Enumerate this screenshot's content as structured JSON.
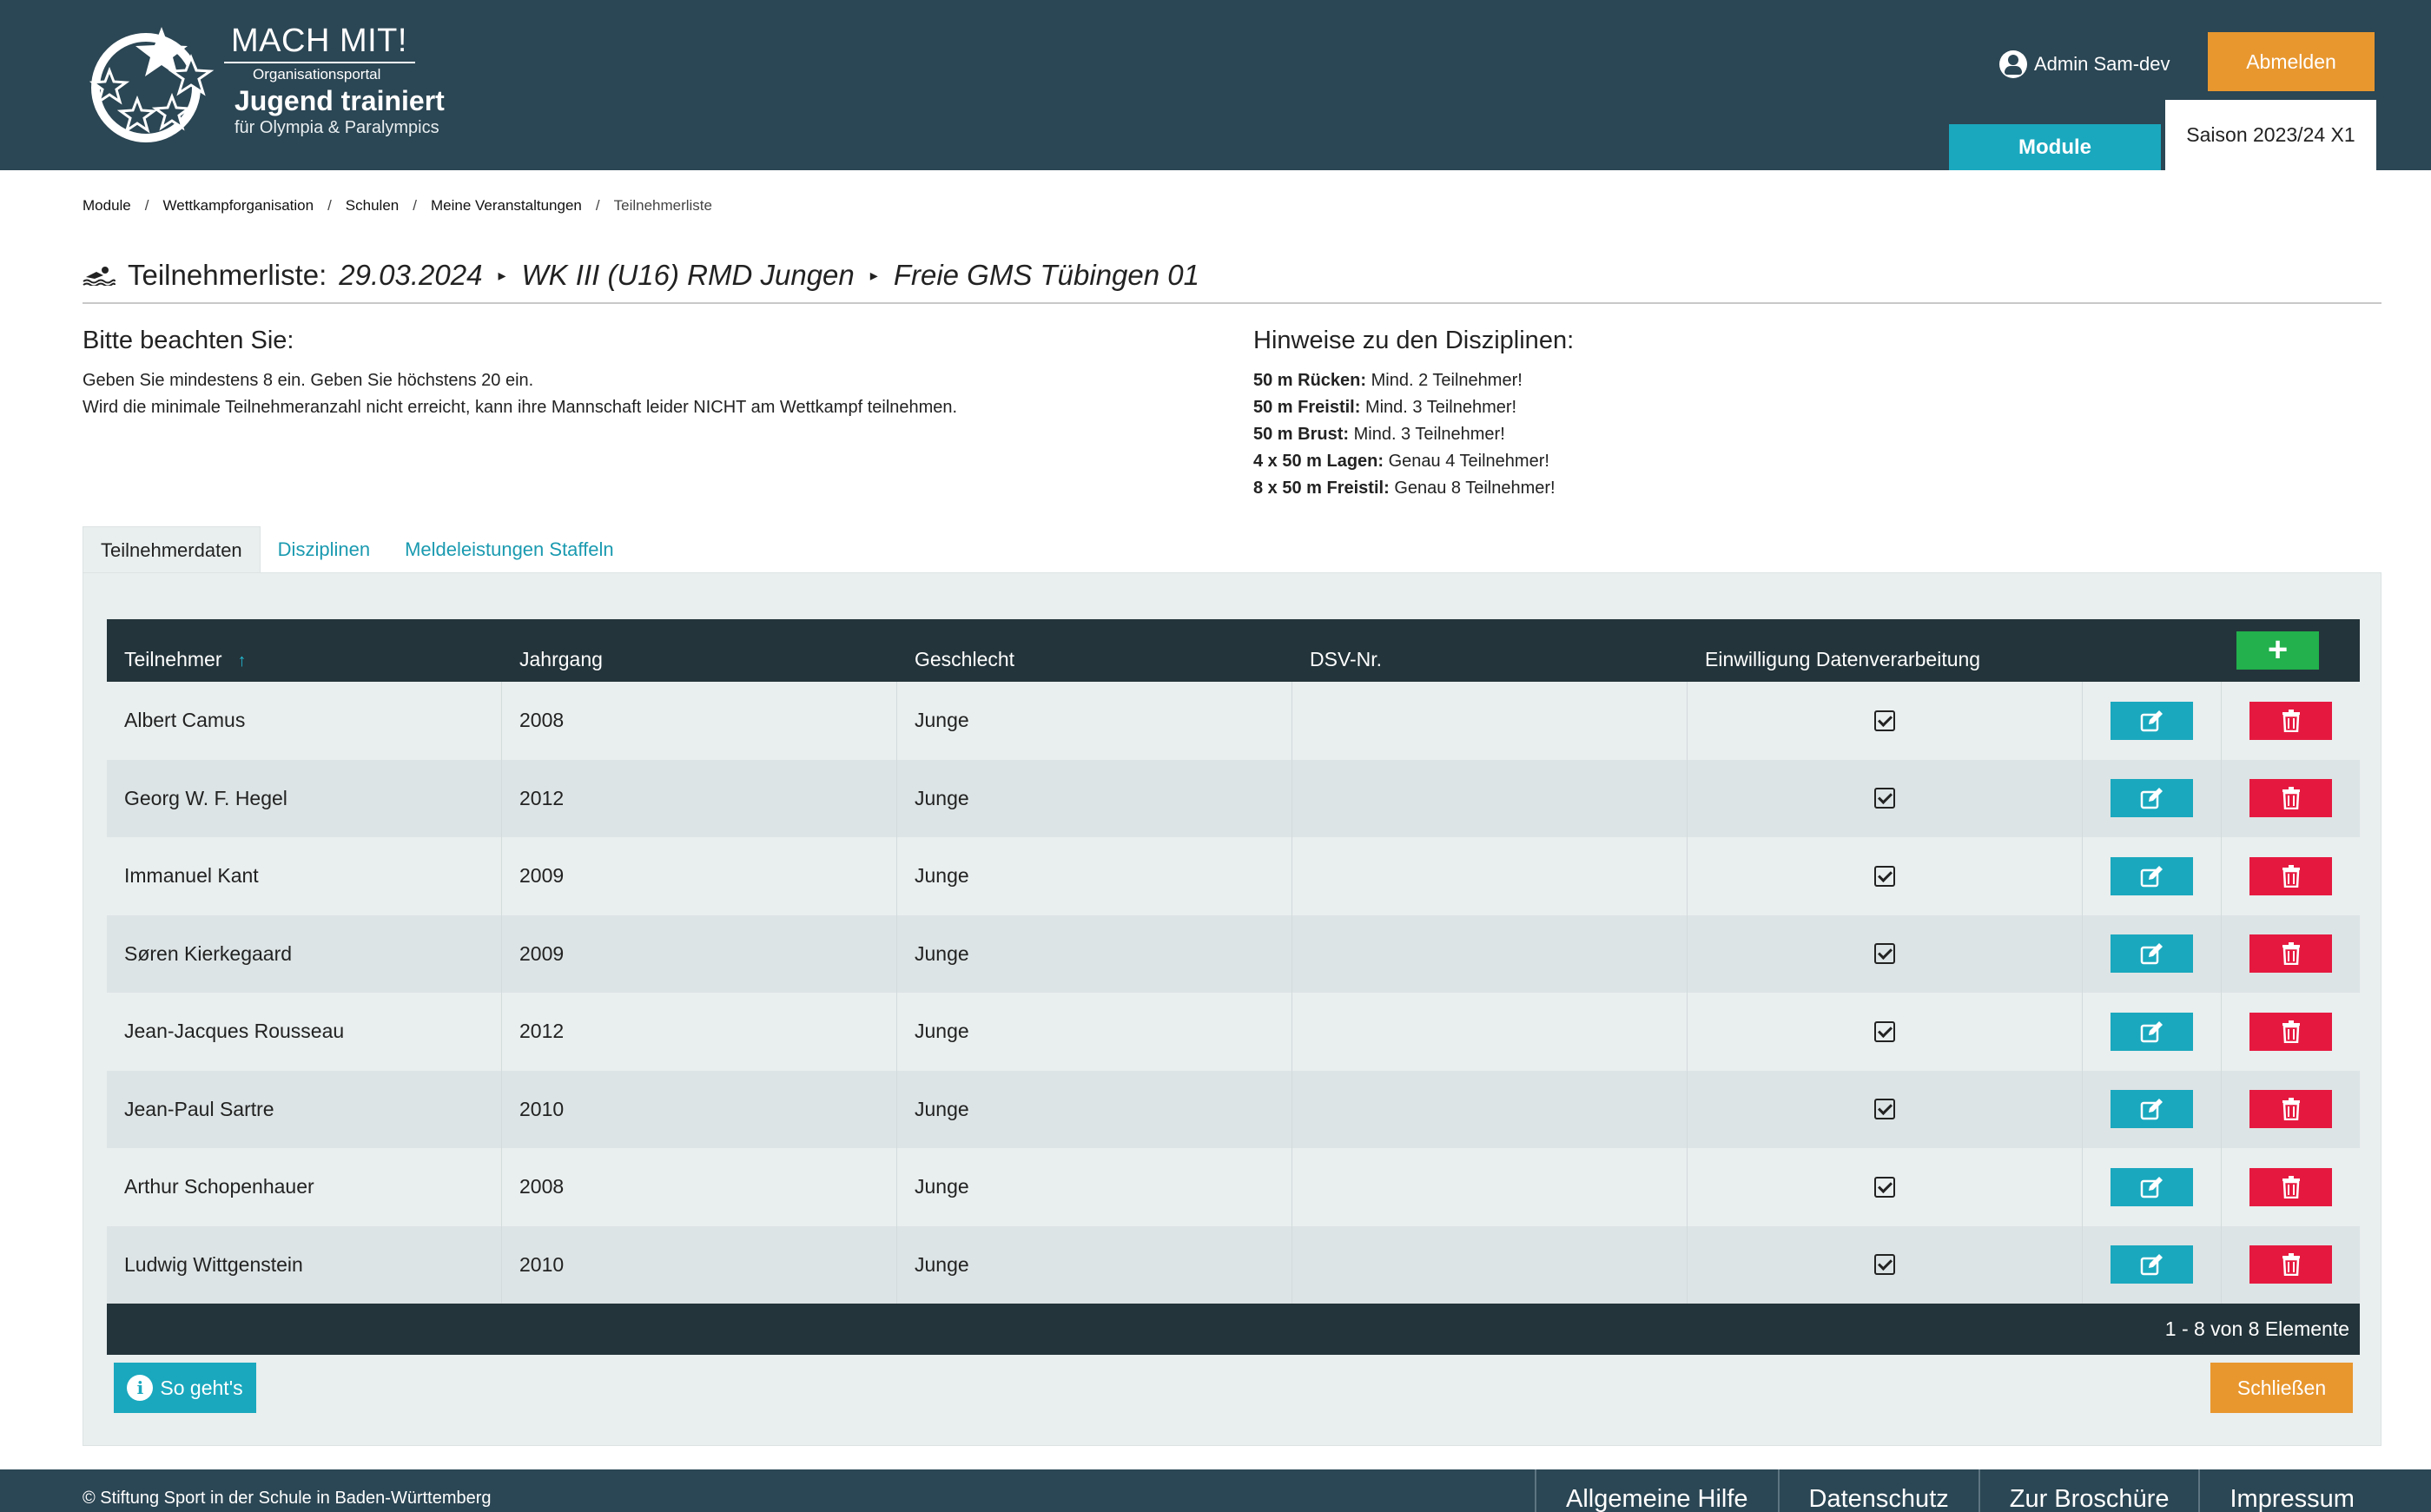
{
  "header": {
    "logo_title": "MACH MIT!",
    "logo_subtitle": "Organisationsportal",
    "logo_brand": "Jugend trainiert",
    "logo_tagline": "für Olympia & Paralympics",
    "user_name": "Admin Sam-dev",
    "logout_label": "Abmelden",
    "module_tab_label": "Module",
    "season_label": "Saison 2023/24 X1"
  },
  "breadcrumb": [
    "Module",
    "Wettkampforganisation",
    "Schulen",
    "Meine Veranstaltungen",
    "Teilnehmerliste"
  ],
  "title": {
    "prefix": "Teilnehmerliste:",
    "date": "29.03.2024",
    "competition": "WK III (U16) RMD Jungen",
    "school": "Freie GMS Tübingen 01"
  },
  "notes": {
    "heading": "Bitte beachten Sie:",
    "line1": "Geben Sie mindestens 8 ein. Geben Sie höchstens 20 ein.",
    "line2": "Wird die minimale Teilnehmeranzahl nicht erreicht, kann ihre Mannschaft leider NICHT am Wettkampf teilnehmen."
  },
  "disciplines": {
    "heading": "Hinweise zu den Disziplinen:",
    "items": [
      {
        "name": "50 m Rücken:",
        "text": "Mind. 2 Teilnehmer!"
      },
      {
        "name": "50 m Freistil:",
        "text": "Mind. 3 Teilnehmer!"
      },
      {
        "name": "50 m Brust:",
        "text": "Mind. 3 Teilnehmer!"
      },
      {
        "name": "4 x 50 m Lagen:",
        "text": "Genau 4 Teilnehmer!"
      },
      {
        "name": "8 x 50 m Freistil:",
        "text": "Genau 8 Teilnehmer!"
      }
    ]
  },
  "tabs": [
    "Teilnehmerdaten",
    "Disziplinen",
    "Meldeleistungen Staffeln"
  ],
  "table": {
    "columns": [
      "Teilnehmer",
      "Jahrgang",
      "Geschlecht",
      "DSV-Nr.",
      "Einwilligung Datenverarbeitung"
    ],
    "sort_indicator": "↑",
    "add_label": "+",
    "rows": [
      {
        "name": "Albert Camus",
        "year": "2008",
        "gender": "Junge",
        "dsv": "",
        "consent": true
      },
      {
        "name": "Georg W. F. Hegel",
        "year": "2012",
        "gender": "Junge",
        "dsv": "",
        "consent": true
      },
      {
        "name": "Immanuel Kant",
        "year": "2009",
        "gender": "Junge",
        "dsv": "",
        "consent": true
      },
      {
        "name": "Søren Kierkegaard",
        "year": "2009",
        "gender": "Junge",
        "dsv": "",
        "consent": true
      },
      {
        "name": "Jean-Jacques Rousseau",
        "year": "2012",
        "gender": "Junge",
        "dsv": "",
        "consent": true
      },
      {
        "name": "Jean-Paul Sartre",
        "year": "2010",
        "gender": "Junge",
        "dsv": "",
        "consent": true
      },
      {
        "name": "Arthur Schopenhauer",
        "year": "2008",
        "gender": "Junge",
        "dsv": "",
        "consent": true
      },
      {
        "name": "Ludwig Wittgenstein",
        "year": "2010",
        "gender": "Junge",
        "dsv": "",
        "consent": true
      }
    ],
    "footer_count": "1 - 8 von 8 Elemente"
  },
  "buttons": {
    "help_label": "So geht's",
    "close_label": "Schließen"
  },
  "footer": {
    "copyright": "© Stiftung Sport in der Schule in Baden-Württemberg",
    "links": [
      "Allgemeine Hilfe",
      "Datenschutz",
      "Zur Broschüre",
      "Impressum"
    ]
  },
  "colors": {
    "header_bg": "#2b4654",
    "accent_teal": "#1aa8be",
    "accent_orange": "#e8972f",
    "delete_red": "#e5193f",
    "add_green": "#22b14c",
    "table_head": "#23343a"
  }
}
